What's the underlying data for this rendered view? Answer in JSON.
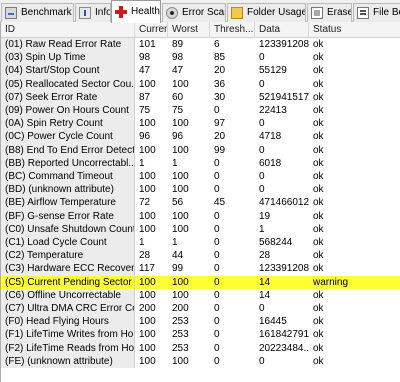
{
  "tabs": [
    {
      "label": "Benchmark",
      "icon": "benchmark-icon"
    },
    {
      "label": "Info",
      "icon": "info-icon"
    },
    {
      "label": "Health",
      "icon": "health-cross-icon",
      "active": true
    },
    {
      "label": "Error Scan",
      "icon": "error-scan-icon"
    },
    {
      "label": "Folder Usage",
      "icon": "folder-icon"
    },
    {
      "label": "Erase",
      "icon": "erase-icon"
    },
    {
      "label": "File Be",
      "icon": "file-icon"
    }
  ],
  "columns": [
    "ID",
    "Current",
    "Worst",
    "Thresh...",
    "Data",
    "Status"
  ],
  "rows": [
    {
      "id": "(01) Raw Read Error Rate",
      "current": "101",
      "worst": "89",
      "thresh": "6",
      "data": "123391208",
      "status": "ok"
    },
    {
      "id": "(03) Spin Up Time",
      "current": "98",
      "worst": "98",
      "thresh": "85",
      "data": "0",
      "status": "ok"
    },
    {
      "id": "(04) Start/Stop Count",
      "current": "47",
      "worst": "47",
      "thresh": "20",
      "data": "55129",
      "status": "ok"
    },
    {
      "id": "(05) Reallocated Sector Cou...",
      "current": "100",
      "worst": "100",
      "thresh": "36",
      "data": "0",
      "status": "ok"
    },
    {
      "id": "(07) Seek Error Rate",
      "current": "87",
      "worst": "60",
      "thresh": "30",
      "data": "521941517",
      "status": "ok"
    },
    {
      "id": "(09) Power On Hours Count",
      "current": "75",
      "worst": "75",
      "thresh": "0",
      "data": "22413",
      "status": "ok"
    },
    {
      "id": "(0A) Spin Retry Count",
      "current": "100",
      "worst": "100",
      "thresh": "97",
      "data": "0",
      "status": "ok"
    },
    {
      "id": "(0C) Power Cycle Count",
      "current": "96",
      "worst": "96",
      "thresh": "20",
      "data": "4718",
      "status": "ok"
    },
    {
      "id": "(B8) End To End Error Detect...",
      "current": "100",
      "worst": "100",
      "thresh": "99",
      "data": "0",
      "status": "ok"
    },
    {
      "id": "(BB) Reported Uncorrectabl...",
      "current": "1",
      "worst": "1",
      "thresh": "0",
      "data": "6018",
      "status": "ok"
    },
    {
      "id": "(BC) Command Timeout",
      "current": "100",
      "worst": "100",
      "thresh": "0",
      "data": "0",
      "status": "ok"
    },
    {
      "id": "(BD) (unknown attribute)",
      "current": "100",
      "worst": "100",
      "thresh": "0",
      "data": "0",
      "status": "ok"
    },
    {
      "id": "(BE) Airflow Temperature",
      "current": "72",
      "worst": "56",
      "thresh": "45",
      "data": "471466012",
      "status": "ok"
    },
    {
      "id": "(BF) G-sense Error Rate",
      "current": "100",
      "worst": "100",
      "thresh": "0",
      "data": "19",
      "status": "ok"
    },
    {
      "id": "(C0) Unsafe Shutdown Count ...",
      "current": "100",
      "worst": "100",
      "thresh": "0",
      "data": "1",
      "status": "ok"
    },
    {
      "id": "(C1) Load Cycle Count",
      "current": "1",
      "worst": "1",
      "thresh": "0",
      "data": "568244",
      "status": "ok"
    },
    {
      "id": "(C2) Temperature",
      "current": "28",
      "worst": "44",
      "thresh": "0",
      "data": "28",
      "status": "ok"
    },
    {
      "id": "(C3) Hardware ECC Recover...",
      "current": "117",
      "worst": "99",
      "thresh": "0",
      "data": "123391208",
      "status": "ok"
    },
    {
      "id": "(C5) Current Pending Sector ...",
      "current": "100",
      "worst": "100",
      "thresh": "0",
      "data": "14",
      "status": "warning",
      "highlight": "#ffff33"
    },
    {
      "id": "(C6) Offline Uncorrectable",
      "current": "100",
      "worst": "100",
      "thresh": "0",
      "data": "14",
      "status": "ok"
    },
    {
      "id": "(C7) Ultra DMA CRC Error Co...",
      "current": "200",
      "worst": "200",
      "thresh": "0",
      "data": "0",
      "status": "ok"
    },
    {
      "id": "(F0) Head Flying Hours",
      "current": "100",
      "worst": "253",
      "thresh": "0",
      "data": "16445",
      "status": "ok"
    },
    {
      "id": "(F1) LifeTime Writes from Ho...",
      "current": "100",
      "worst": "253",
      "thresh": "0",
      "data": "161842791",
      "status": "ok"
    },
    {
      "id": "(F2) LifeTime Reads from Ho...",
      "current": "100",
      "worst": "253",
      "thresh": "0",
      "data": "20223484...",
      "status": "ok"
    },
    {
      "id": "(FE) (unknown attribute)",
      "current": "100",
      "worst": "100",
      "thresh": "0",
      "data": "0",
      "status": "ok"
    }
  ]
}
